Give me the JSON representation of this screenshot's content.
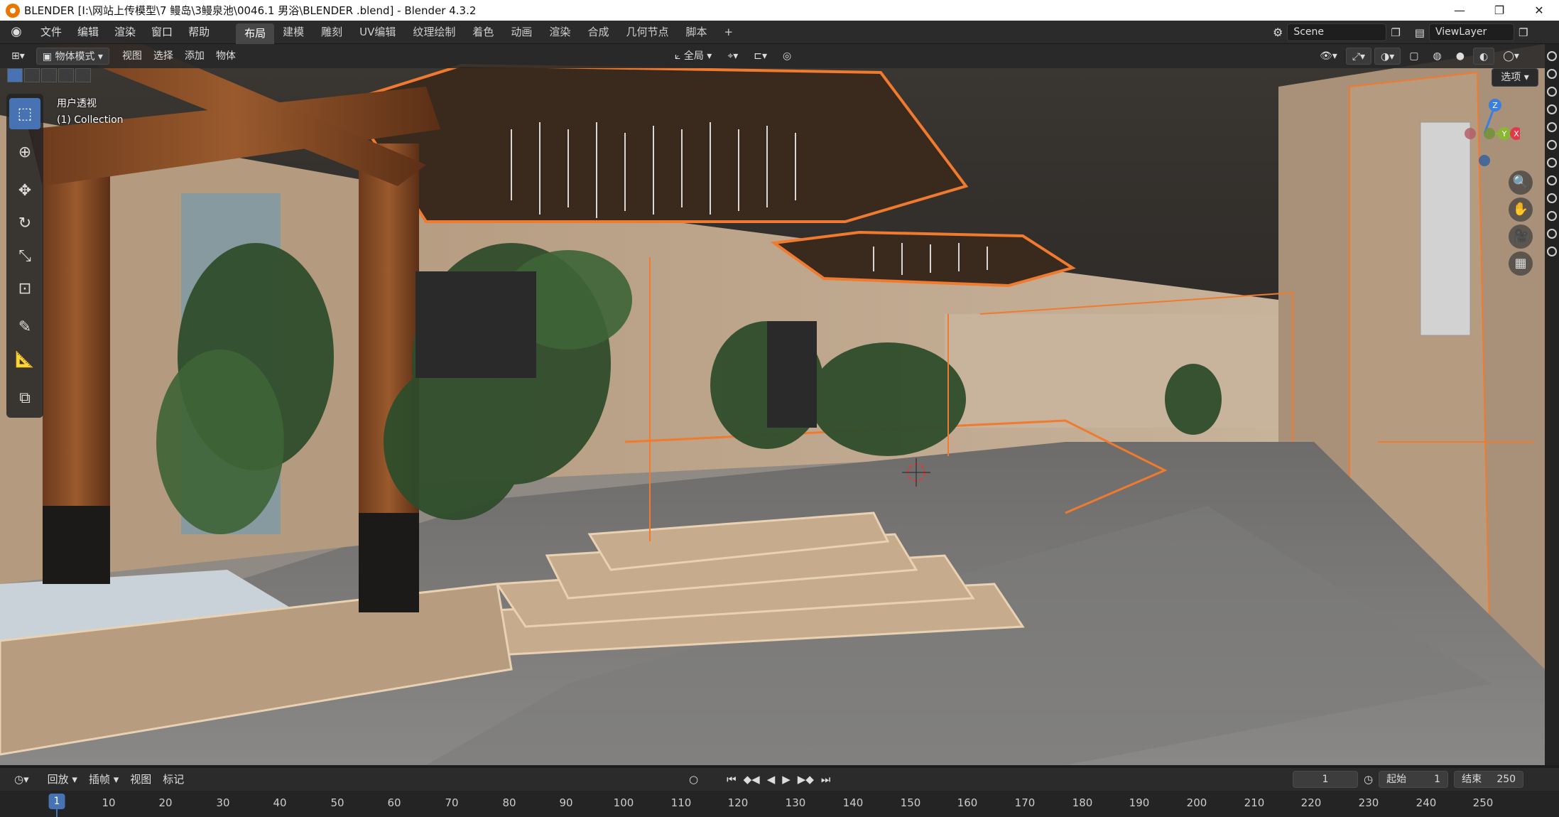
{
  "window": {
    "title": "BLENDER  [I:\\网站上传模型\\7 鳗岛\\3鳗泉池\\0046.1 男浴\\BLENDER .blend] - Blender 4.3.2",
    "controls": [
      "—",
      "❐",
      "✕"
    ]
  },
  "menubar": {
    "menus": [
      "文件",
      "编辑",
      "渲染",
      "窗口",
      "帮助"
    ],
    "workspaces": [
      "布局",
      "建模",
      "雕刻",
      "UV编辑",
      "纹理绘制",
      "着色",
      "动画",
      "渲染",
      "合成",
      "几何节点",
      "脚本"
    ],
    "active_workspace": "布局",
    "add_tab": "+",
    "scene": "Scene",
    "view_layer": "ViewLayer"
  },
  "viewport_header": {
    "mode": "物体模式",
    "menus": [
      "视图",
      "选择",
      "添加",
      "物体"
    ],
    "transform_orientation": "全局",
    "options_label": "选项"
  },
  "viewport": {
    "view_name": "用户透视",
    "collection": "(1) Collection",
    "gizmo_axes": [
      "Z",
      "Y",
      "X"
    ],
    "colors": {
      "x": "#e2394b",
      "y": "#8ab832",
      "z": "#3a7ede",
      "selection": "#f07a2e"
    }
  },
  "timeline": {
    "menus": [
      "回放",
      "插帧",
      "视图",
      "标记"
    ],
    "current_frame": "1",
    "start_label": "起始",
    "start": "1",
    "end_label": "结束",
    "end": "250",
    "ruler_labels": [
      "1",
      "10",
      "20",
      "30",
      "40",
      "50",
      "60",
      "70",
      "80",
      "90",
      "100",
      "110",
      "120",
      "130",
      "140",
      "150",
      "160",
      "170",
      "180",
      "190",
      "200",
      "210",
      "220",
      "230",
      "240",
      "250"
    ]
  }
}
